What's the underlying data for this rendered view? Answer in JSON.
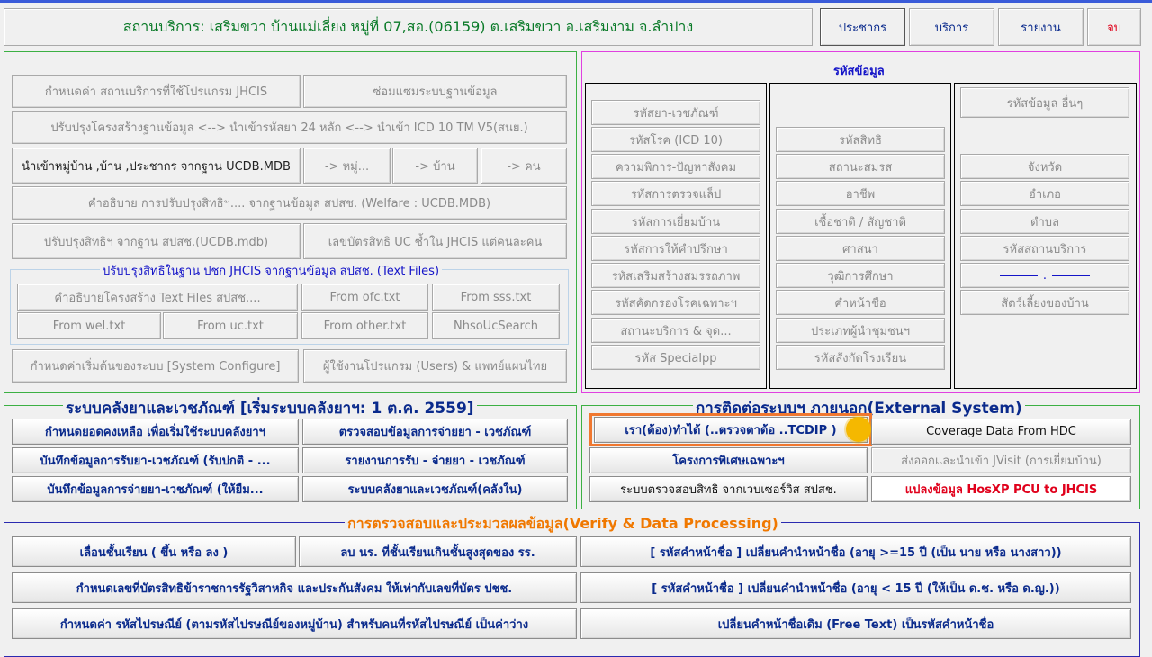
{
  "header": {
    "title": "สถานบริการ: เสริมขวา บ้านแม่เลี่ยง หมู่ที่ 07,สอ.(06159) ต.เสริมขวา อ.เสริมงาม จ.ลำปาง",
    "nav": [
      "ประชากร",
      "บริการ",
      "รายงาน",
      "จบ"
    ]
  },
  "setup": {
    "buttons": [
      "กำหนดค่า สถานบริการที่ใช้โปรแกรม JHCIS",
      "ซ่อมแซมระบบฐานข้อมูล",
      "ปรับปรุงโครงสร้างฐานข้อมูล <--> นำเข้ารหัสยา 24 หลัก <--> นำเข้า ICD 10 TM V5(สนย.)",
      "นำเข้าหมู่บ้าน ,บ้าน ,ประชากร จากฐาน UCDB.MDB",
      "-> หมู่...",
      "-> บ้าน",
      "-> คน",
      "คำอธิบาย การปรับปรุงสิทธิฯ.... จากฐานข้อมูล สปสช. (Welfare : UCDB.MDB)",
      "ปรับปรุงสิทธิฯ จากฐาน สปสช.(UCDB.mdb)",
      "เลขบัตรสิทธิ UC ซ้ำใน JHCIS แต่คนละคน"
    ],
    "textfiles_legend": "ปรับปรุงสิทธิในฐาน ปชก JHCIS จากฐานข้อมูล สปสช. (Text Files)",
    "textfiles": [
      "คำอธิบายโครงสร้าง Text Files สปสช....",
      "From ofc.txt",
      "From sss.txt",
      "From wel.txt",
      "From uc.txt",
      "From other.txt",
      "NhsoUcSearch"
    ],
    "bottom": [
      "กำหนดค่าเริ่มต้นของระบบ [System Configure]",
      "ผู้ใช้งานโปรแกรม (Users) & แพทย์แผนไทย"
    ]
  },
  "codes": {
    "title": "รหัสข้อมูล",
    "col1": [
      "รหัสยา-เวชภัณฑ์",
      "รหัสโรค (ICD 10)",
      "ความพิการ-ปัญหาสังคม",
      "รหัสการตรวจแล็ป",
      "รหัสการเยี่ยมบ้าน",
      "รหัสการให้คำปรึกษา",
      "รหัสเสริมสร้างสมรรถภาพ",
      "รหัสคัดกรองโรคเฉพาะฯ",
      "สถานะบริการ & จุด...",
      "รหัส Specialpp"
    ],
    "col2": [
      "รหัสสิทธิ",
      "สถานะสมรส",
      "อาชีพ",
      "เชื้อชาติ / สัญชาติ",
      "ศาสนา",
      "วุฒิการศึกษา",
      "คำหน้าชื่อ",
      "ประเภทผู้นำชุมชนฯ",
      "รหัสสังกัดโรงเรียน"
    ],
    "col3": [
      "รหัสข้อมูล อื่นๆ",
      "จังหวัด",
      "อำเภอ",
      "ตำบล",
      "รหัสสถานบริการ",
      "สัตว์เลี้ยงของบ้าน"
    ],
    "separator": "."
  },
  "inventory": {
    "legend": "ระบบคลังยาและเวชภัณฑ์ [เริ่มระบบคลังยาฯ: 1 ต.ค. 2559]",
    "buttons": [
      "กำหนดยอดคงเหลือ เพื่อเริ่มใช้ระบบคลังยาฯ",
      "ตรวจสอบข้อมูลการจ่ายยา - เวชภัณฑ์",
      "บันทึกข้อมูลการรับยา-เวชภัณฑ์ (รับปกติ - ...",
      "รายงานการรับ - จ่ายยา - เวชภัณฑ์",
      "บันทึกข้อมูลการจ่ายยา-เวชภัณฑ์ (ให้ยืม...",
      "ระบบคลังยาและเวชภัณฑ์(คลังใน)"
    ]
  },
  "external": {
    "legend": "การติดต่อระบบฯ ภายนอก(External System)",
    "buttons": [
      "เรา(ต้อง)ทำได้ (..ตรวจตาต้อ ..TCDIP )",
      "Coverage Data From HDC",
      "โครงการพิเศษเฉพาะฯ",
      "ส่งออกและนำเข้า JVisit (การเยี่ยมบ้าน)",
      "ระบบตรวจสอบสิทธิ จากเวบเซอร์วิส สปสช.",
      "แปลงข้อมูล HosXP PCU to JHCIS"
    ]
  },
  "verify": {
    "legend": "การตรวจสอบและประมวลผลข้อมูล(Verify & Data Processing)",
    "buttons": [
      "เลื่อนชั้นเรียน ( ขึ้น หรือ ลง )",
      "ลบ นร. ที่ชั้นเรียนเกินชั้นสูงสุดของ รร.",
      "[ รหัสคำหน้าชื่อ ] เปลี่ยนคำนำหน้าชื่อ (อายุ >=15 ปี (เป็น นาย หรือ นางสาว))",
      "กำหนดเลขที่บัตรสิทธิข้าราชการรัฐวิสาหกิจ และประกันสังคม ให้เท่ากับเลขที่บัตร ปชช.",
      "[ รหัสคำหน้าชื่อ ] เปลี่ยนคำนำหน้าชื่อ (อายุ < 15 ปี (ให้เป็น ด.ช. หรือ ด.ญ.))",
      "กำหนดค่า รหัสไปรษณีย์ (ตามรหัสไปรษณีย์ของหมู่บ้าน) สำหรับคนที่รหัสไปรษณีย์ เป็นค่าว่าง",
      "เปลี่ยนคำหน้าชื่อเดิม (Free Text) เป็นรหัสคำหน้าชื่อ"
    ]
  }
}
